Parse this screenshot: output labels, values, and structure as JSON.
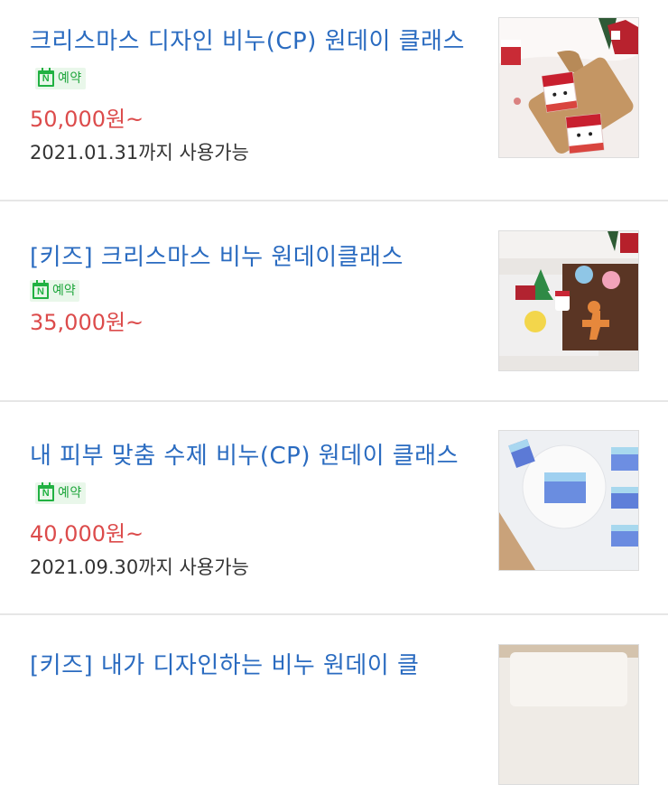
{
  "badge_label": "예약",
  "items": [
    {
      "title": "크리스마스 디자인 비누(CP) 원데이 클래스",
      "price": "50,000원~",
      "validity": "2021.01.31까지 사용가능",
      "image": "christmas-soap-santa-photo"
    },
    {
      "title": "[키즈] 크리스마스 비누 원데이클래스",
      "price": "35,000원~",
      "validity": "",
      "image": "christmas-kids-soap-photo"
    },
    {
      "title": "내 피부 맞춤 수제 비누(CP) 원데이 클래스",
      "price": "40,000원~",
      "validity": "2021.09.30까지 사용가능",
      "image": "blue-handmade-soap-photo"
    },
    {
      "title": "[키즈] 내가 디자인하는 비누 원데이 클",
      "image": "soap-photo"
    }
  ],
  "colors": {
    "title": "#2a6bc0",
    "price": "#dc4b4b",
    "badge_green": "#21b142",
    "badge_bg": "#e9f7ea"
  }
}
